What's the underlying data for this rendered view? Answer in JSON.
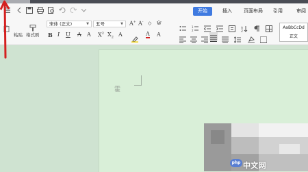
{
  "ribbon": {
    "tabs": [
      {
        "label": "开始",
        "active": true
      },
      {
        "label": "插入"
      },
      {
        "label": "页面布局"
      },
      {
        "label": "引用"
      },
      {
        "label": "审阅"
      }
    ],
    "paste_label": "粘贴",
    "format_painter_label": "格式刷",
    "font_name": "宋体 (正文)",
    "font_size": "五号",
    "style_sample": "AaBbCcDd",
    "style_name": "正文"
  },
  "document": {
    "text": "霍"
  },
  "watermark": {
    "logo": "php",
    "site": "中文网"
  },
  "colors": {
    "accent": "#3f7ae0",
    "page": "#d9efd8",
    "workspace": "#cfe3d1",
    "annotation": "#d42020"
  }
}
